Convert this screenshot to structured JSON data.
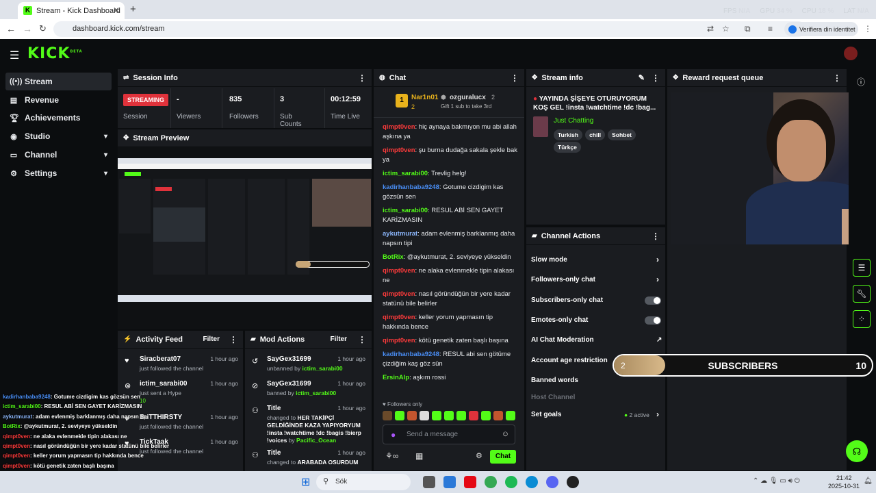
{
  "browser": {
    "tab_title": "Stream - Kick Dashboard",
    "url": "dashboard.kick.com/stream",
    "verify_label": "Verifiera din identitet",
    "overlay": {
      "fps_label": "FPS",
      "fps_val": "N/A",
      "gpu_label": "GPU",
      "gpu_val": "34 %",
      "cpu_label": "CPU",
      "cpu_val": "18 %",
      "lat_label": "LAT",
      "lat_val": "N/A"
    }
  },
  "app": {
    "logo": "KICK",
    "logo_sup": "BETA"
  },
  "sidebar": {
    "items": [
      {
        "label": "Stream"
      },
      {
        "label": "Revenue"
      },
      {
        "label": "Achievements"
      },
      {
        "label": "Studio"
      },
      {
        "label": "Channel"
      },
      {
        "label": "Settings"
      }
    ]
  },
  "session": {
    "title": "Session Info",
    "status": "STREAMING",
    "status_label": "Session",
    "viewers_val": "-",
    "viewers_label": "Viewers",
    "followers_val": "835",
    "followers_label": "Followers",
    "subs_val": "3",
    "subs_label": "Sub Counts",
    "time_val": "00:12:59",
    "time_label": "Time Live"
  },
  "preview": {
    "title": "Stream Preview"
  },
  "activity": {
    "title": "Activity Feed",
    "filter": "Filter",
    "items": [
      {
        "name": "Siracberat07",
        "desc": "just followed the channel",
        "time": "1 hour ago"
      },
      {
        "name": "ictim_sarabi00",
        "desc": "just sent a Hype",
        "extra": "10",
        "time": "1 hour ago"
      },
      {
        "name": "BuTTHIRSTY",
        "desc": "just followed the channel",
        "time": "1 hour ago"
      },
      {
        "name": "TickTaak",
        "desc": "just followed the channel",
        "time": "1 hour ago"
      }
    ]
  },
  "mod": {
    "title": "Mod Actions",
    "filter": "Filter",
    "items": [
      {
        "name": "SayGex31699",
        "desc": "unbanned by",
        "by": "ictim_sarabi00",
        "time": "1 hour ago"
      },
      {
        "name": "SayGex31699",
        "desc": "banned by",
        "by": "ictim_sarabi00",
        "time": "1 hour ago"
      },
      {
        "name": "Title",
        "desc": "changed to",
        "val": "HER TAKİPÇİ GELDİĞİNDE KAZA YAPIYORYUM !insta !watchtime !dc !bagis !bierp !voices",
        "by_label": "by",
        "by": "Pacific_Ocean",
        "time": "1 hour ago"
      },
      {
        "name": "Title",
        "desc": "changed to",
        "val": "ARABADA OSURDUM",
        "time": "1 hour ago"
      }
    ]
  },
  "chat": {
    "title": "Chat",
    "top_gifter": {
      "rank": "1",
      "name": "Nar1n01",
      "count": "2"
    },
    "second_gifter": {
      "name": "ozguralucx",
      "count": "2"
    },
    "gift_hint": "Gift 1 sub to take 3rd",
    "messages": [
      {
        "user": "qimpt0ven",
        "color": "#ff3b3b",
        "text": "hiç aynaya bakmıyon mu abi allah aşkına ya"
      },
      {
        "user": "qimpt0ven",
        "color": "#ff3b3b",
        "text": "şu burna dudağa sakala şekle bak ya"
      },
      {
        "user": "ictim_sarabi00",
        "color": "#53fc18",
        "text": "Trevlig helg!"
      },
      {
        "user": "kadirhanbaba9248",
        "color": "#4a8ff7",
        "text": "Gotume cizdigim kas gözsün sen"
      },
      {
        "user": "ictim_sarabi00",
        "color": "#53fc18",
        "text": "RESUL ABİ SEN GAYET KARİZMASIN"
      },
      {
        "user": "aykutmurat",
        "color": "#8ab4f8",
        "text": "adam evlenmiş barklanmış daha napsın tipi"
      },
      {
        "user": "BotRix",
        "color": "#53fc18",
        "text": "@aykutmurat, 2. seviyeye yükseldin"
      },
      {
        "user": "qimpt0ven",
        "color": "#ff3b3b",
        "text": "ne alaka evlenmekle tipin alakası ne"
      },
      {
        "user": "qimpt0ven",
        "color": "#ff3b3b",
        "text": "nasıl göründüğün bir yere kadar statünü bile belirler"
      },
      {
        "user": "qimpt0ven",
        "color": "#ff3b3b",
        "text": "keller yorum yapmasın tip hakkında bence"
      },
      {
        "user": "qimpt0ven",
        "color": "#ff3b3b",
        "text": "kötü genetik zaten başlı başına"
      },
      {
        "user": "kadirhanbaba9248",
        "color": "#4a8ff7",
        "text": "RESUL abi sen götüme çizdiğim kaş göz sün"
      },
      {
        "user": "ErsinAlp",
        "color": "#53fc18",
        "text": "aşkım rossi"
      }
    ],
    "followers_only": "Followers only",
    "placeholder": "Send a message",
    "send": "Chat"
  },
  "stream_info": {
    "title": "Stream info",
    "stream_title": "YAYINDA ŞİŞEYE OTURUYORUM KOŞ GEL !insta !watchtime !dc !bag...",
    "category": "Just Chatting",
    "tags": [
      "Turkish",
      "chill",
      "Sohbet",
      "Türkçe"
    ]
  },
  "channel_actions": {
    "title": "Channel Actions",
    "items": [
      {
        "label": "Slow mode"
      },
      {
        "label": "Followers-only chat"
      },
      {
        "label": "Subscribers-only chat"
      },
      {
        "label": "Emotes-only chat"
      },
      {
        "label": "AI Chat Moderation"
      },
      {
        "label": "Account age restriction"
      },
      {
        "label": "Banned words"
      },
      {
        "label": "Host Channel"
      },
      {
        "label": "Set goals"
      }
    ],
    "goals_active": "2 active"
  },
  "reward": {
    "title": "Reward request queue"
  },
  "subs_overlay": {
    "current": "2",
    "label": "SUBSCRIBERS",
    "goal": "10",
    "progress": 0.2
  },
  "overlay_chat": [
    {
      "user": "kadirhanbaba9248",
      "text": ": Gotume cizdigim kas gözsün sen",
      "color": "#4a8ff7"
    },
    {
      "user": "ictim_sarabi00",
      "text": ": RESUL ABİ SEN GAYET KARİZMASIN",
      "color": "#53fc18"
    },
    {
      "user": "aykutmurat",
      "text": ": adam evlenmiş barklanmış daha napsın tipi",
      "color": "#8ab4f8"
    },
    {
      "user": "BotRix",
      "text": ": @aykutmurat, 2. seviyeye yükseldin",
      "color": "#53fc18"
    },
    {
      "user": "qimpt0ven",
      "text": ": ne alaka evlenmekle tipin alakası ne",
      "color": "#ff3b3b"
    },
    {
      "user": "qimpt0ven",
      "text": ": nasıl göründüğün bir yere kadar statünü bile belirler",
      "color": "#ff3b3b"
    },
    {
      "user": "qimpt0ven",
      "text": ": keller yorum yapmasın tip hakkında bence",
      "color": "#ff3b3b"
    },
    {
      "user": "qimpt0ven",
      "text": ": kötü genetik zaten başlı başına",
      "color": "#ff3b3b"
    },
    {
      "user": "kadirhanbaba9248",
      "text": ": RESUL abi sen götüme çizdiğim kaş göz sün",
      "color": "#4a8ff7"
    },
    {
      "user": "ErsinAlp",
      "text": ": aşkım rossi",
      "color": "#53fc18"
    }
  ],
  "taskbar": {
    "search": "Sök",
    "time": "21:42",
    "date": "2025-10-31"
  }
}
